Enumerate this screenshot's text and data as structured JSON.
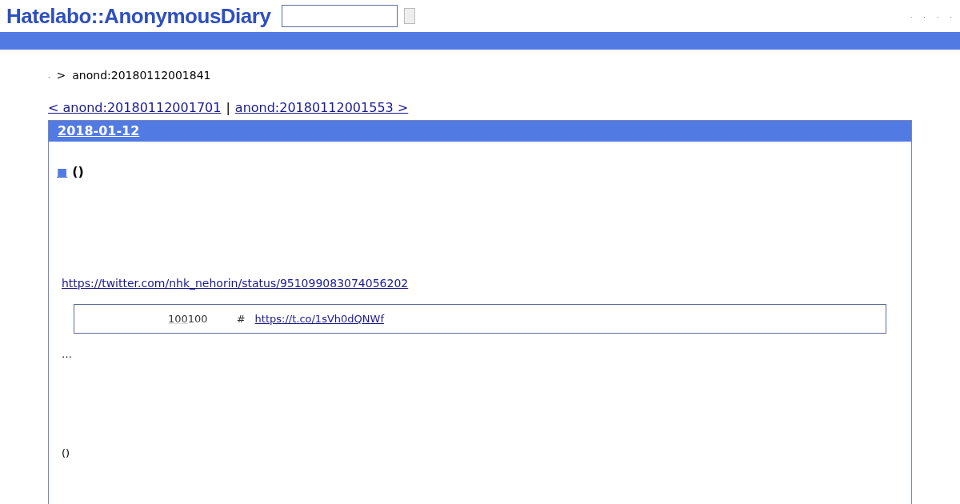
{
  "header": {
    "logo": "Hatelabo::AnonymousDiary",
    "links": [
      ".",
      ".",
      ".",
      "."
    ]
  },
  "breadcrumb": {
    "home": ".",
    "separator": ">",
    "current": "anond:20180112001841"
  },
  "pager": {
    "prev": "< anond:20180112001701",
    "separator": "|",
    "next": "anond:20180112001553 >"
  },
  "day": {
    "date": "2018-01-12",
    "entry": {
      "marker": "■",
      "title": "()"
    },
    "tweet_link": "https://twitter.com/nhk_nehorin/status/951099083074056202",
    "quote": {
      "count_link": "100",
      "count_text": "100",
      "hash": "#",
      "url": "https://t.co/1sVh0dQNWf"
    },
    "ellipsis": "…",
    "closing": "()"
  }
}
